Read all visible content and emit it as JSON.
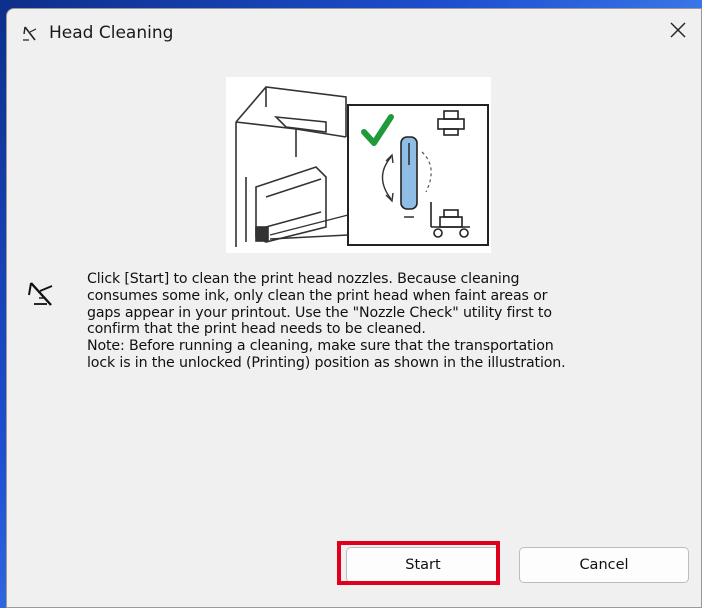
{
  "window": {
    "title": "Head Cleaning"
  },
  "icons": {
    "title_icon": "pen-compass-icon",
    "info_icon": "pen-compass-icon",
    "close_icon": "close-icon"
  },
  "message": {
    "lines": [
      "Click [Start] to clean the print head nozzles. Because cleaning",
      "consumes some ink, only clean the print head when faint areas or",
      "gaps appear in your printout. Use the \"Nozzle Check\" utility first to",
      "confirm that the print head needs to be cleaned.",
      "Note: Before running a cleaning, make sure that the transportation",
      "lock is in the unlocked (Printing) position as shown in the illustration."
    ]
  },
  "buttons": {
    "start_label": "Start",
    "cancel_label": "Cancel"
  },
  "colors": {
    "highlight": "#e0001b",
    "check": "#1f9a3a",
    "lock_blue": "#6fa8dc"
  }
}
